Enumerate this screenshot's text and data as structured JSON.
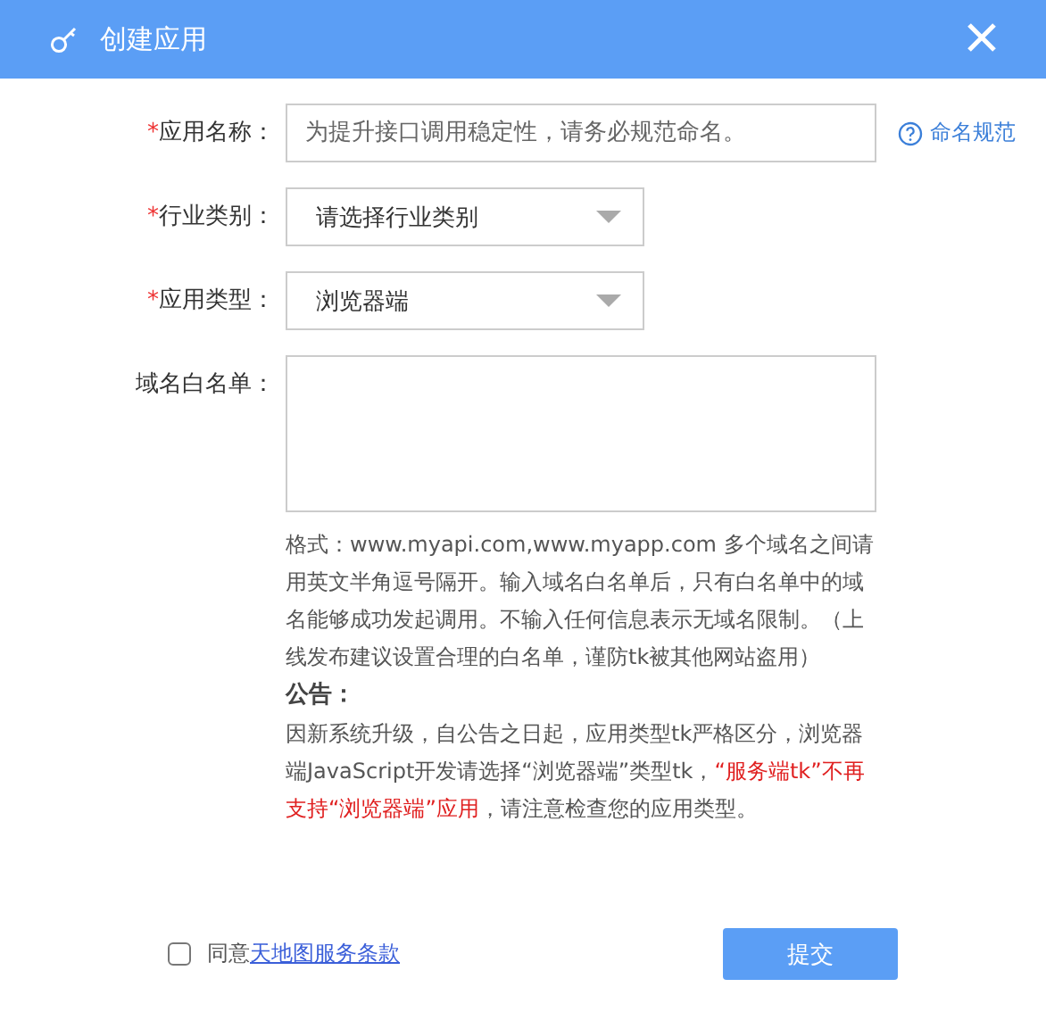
{
  "dialog": {
    "title": "创建应用"
  },
  "fields": [
    {
      "kind": "input",
      "marker": "*",
      "label": "应用名称：",
      "placeholder": "为提升接口调用稳定性，请务必规范命名。",
      "help": "命名规范"
    },
    {
      "kind": "select",
      "marker": "*",
      "label": "行业类别：",
      "value": "请选择行业类别"
    },
    {
      "kind": "select",
      "marker": "*",
      "label": "应用类型：",
      "value": "浏览器端"
    },
    {
      "kind": "textarea",
      "label": "域名白名单："
    }
  ],
  "hint": "格式：www.myapi.com,www.myapp.com 多个域名之间请用英文半角逗号隔开。输入域名白名单后，只有白名单中的域名能够成功发起调用。不输入任何信息表示无域名限制。（上线发布建议设置合理的白名单，谨防tk被其他网站盗用）",
  "notice": {
    "title": "公告：",
    "segments": [
      {
        "text": "因新系统升级，自公告之日起，应用类型tk严格区分，浏览器端JavaScript开发请选择“浏览器端”类型tk，",
        "highlight": false
      },
      {
        "text": "“服务端tk”不再支持“浏览器端”应用",
        "highlight": true
      },
      {
        "text": "，请注意检查您的应用类型。",
        "highlight": false
      }
    ]
  },
  "agreement": {
    "checked": false,
    "prefix": "同意",
    "link": "天地图服务条款"
  },
  "submit": "提交"
}
